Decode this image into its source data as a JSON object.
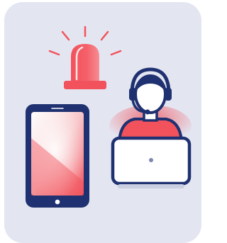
{
  "illustration": {
    "subject": "emergency-support",
    "elements": [
      "alarm-siren",
      "smartphone",
      "support-agent-with-headset",
      "laptop"
    ]
  },
  "colors": {
    "background_card": "#e3e6f1",
    "navy_outline": "#1f3170",
    "alert_red": "#f2525c",
    "alert_red_light": "#f7a3a8",
    "white": "#ffffff",
    "laptop_base": "#c9cfe0"
  }
}
